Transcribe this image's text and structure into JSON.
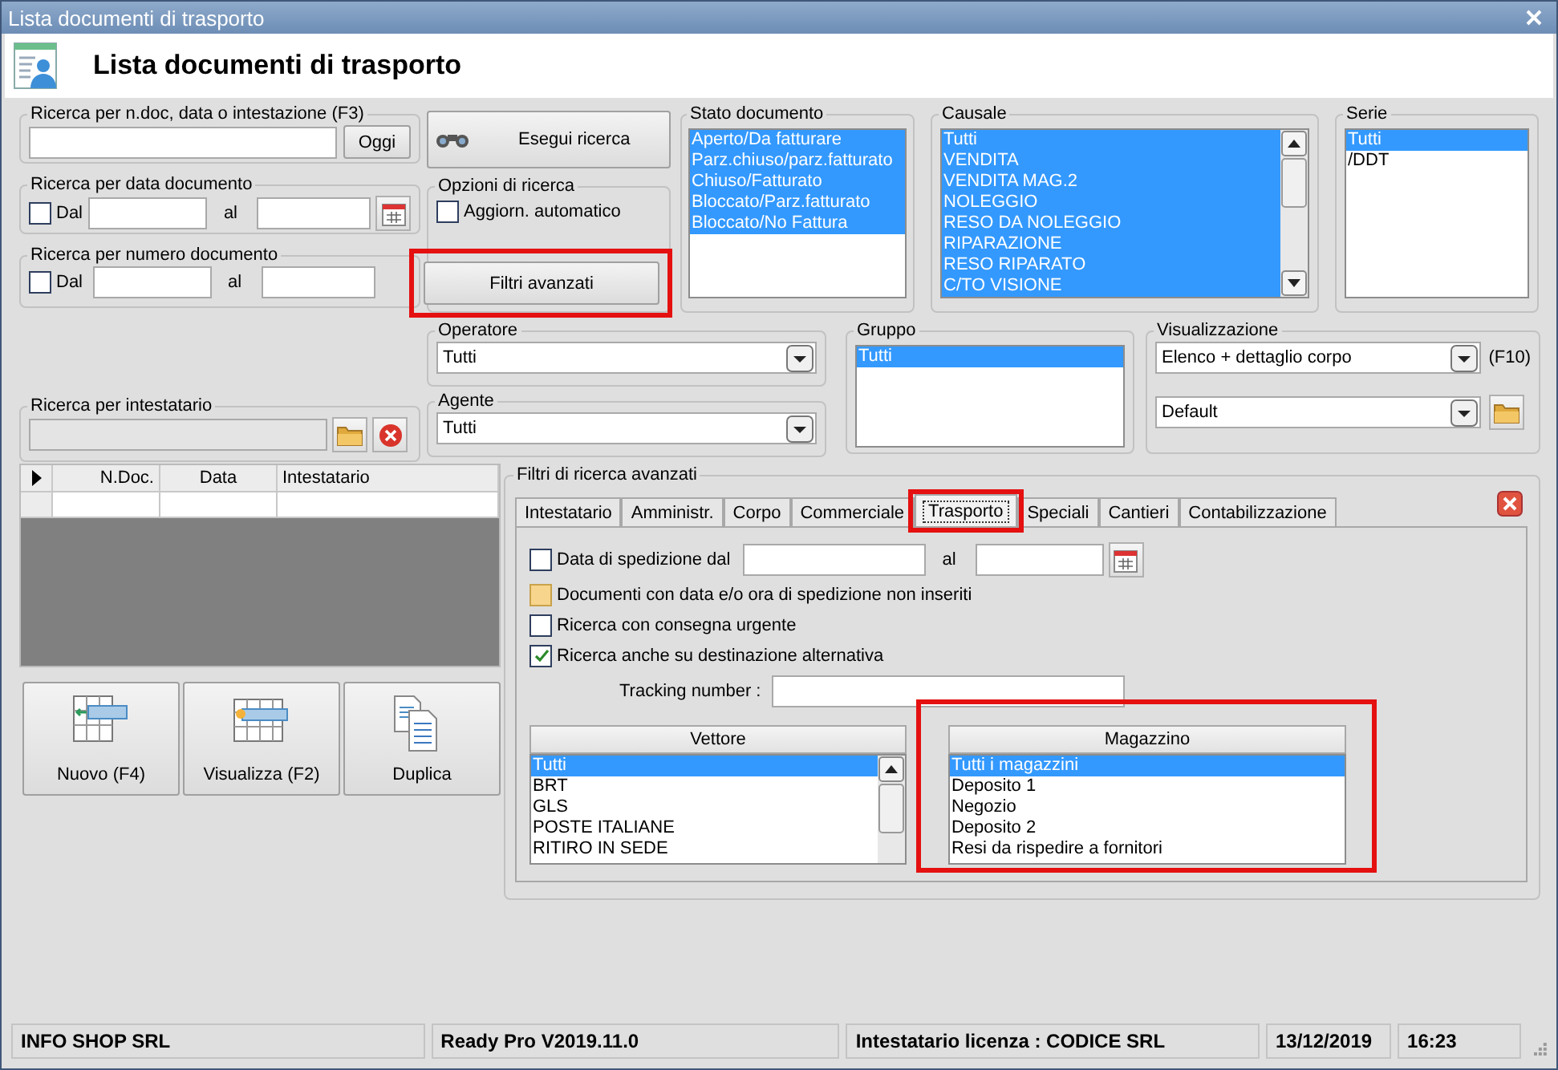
{
  "window": {
    "title": "Lista documenti di trasporto"
  },
  "header": {
    "title": "Lista documenti di trasporto"
  },
  "quick_search": {
    "label": "Ricerca per n.doc, data o intestazione (F3)",
    "button": "Oggi"
  },
  "date_search": {
    "label": "Ricerca per data documento",
    "from": {
      "label": "Dal",
      "checked": false
    },
    "to_label": "al"
  },
  "number_search": {
    "label": "Ricerca per numero documento",
    "from": {
      "label": "Dal",
      "checked": false
    },
    "to_label": "al"
  },
  "owner_search": {
    "label": "Ricerca per intestatario"
  },
  "search_button": "Esegui ricerca",
  "search_options": {
    "label": "Opzioni di ricerca",
    "auto_update": {
      "label": "Aggiorn. automatico",
      "checked": false
    },
    "advanced_button": {
      "label": "Filtri avanzati",
      "annotated": true
    }
  },
  "operator": {
    "label": "Operatore",
    "value": "Tutti"
  },
  "agent": {
    "label": "Agente",
    "value": "Tutti"
  },
  "document_state": {
    "label": "Stato documento",
    "items": [
      {
        "text": "Aperto/Da fatturare",
        "selected": true
      },
      {
        "text": "Parz.chiuso/parz.fatturato",
        "selected": true
      },
      {
        "text": "Chiuso/Fatturato",
        "selected": true
      },
      {
        "text": "Bloccato/Parz.fatturato",
        "selected": true
      },
      {
        "text": "Bloccato/No Fattura",
        "selected": true
      }
    ]
  },
  "reason": {
    "label": "Causale",
    "items": [
      {
        "text": "Tutti",
        "selected": true
      },
      {
        "text": "VENDITA",
        "selected": true
      },
      {
        "text": "VENDITA MAG.2",
        "selected": true
      },
      {
        "text": "NOLEGGIO",
        "selected": true
      },
      {
        "text": "RESO DA NOLEGGIO",
        "selected": true
      },
      {
        "text": "RIPARAZIONE",
        "selected": true
      },
      {
        "text": "RESO RIPARATO",
        "selected": true
      },
      {
        "text": "C/TO VISIONE",
        "selected": true
      }
    ]
  },
  "series": {
    "label": "Serie",
    "items": [
      {
        "text": "Tutti",
        "selected": true
      },
      {
        "text": "/DDT",
        "selected": false
      }
    ]
  },
  "group": {
    "label": "Gruppo",
    "items": [
      {
        "text": "Tutti",
        "selected": true
      }
    ]
  },
  "view": {
    "label": "Visualizzazione",
    "value": "Elenco + dettaglio corpo",
    "shortcut": "(F10)",
    "layout": "Default"
  },
  "table": {
    "columns": [
      "N.Doc.",
      "Data",
      "Intestatario"
    ]
  },
  "actions": [
    {
      "label": "Nuovo (F4)",
      "kind": "new"
    },
    {
      "label": "Visualizza (F2)",
      "kind": "view"
    },
    {
      "label": "Duplica",
      "kind": "copy"
    }
  ],
  "advanced": {
    "title": "Filtri di ricerca avanzati",
    "tabs": [
      {
        "label": "Intestatario",
        "selected": false,
        "annotated": false
      },
      {
        "label": "Amministr.",
        "selected": false,
        "annotated": false
      },
      {
        "label": "Corpo",
        "selected": false,
        "annotated": false
      },
      {
        "label": "Commerciale",
        "selected": false,
        "annotated": false
      },
      {
        "label": "Trasporto",
        "selected": true,
        "annotated": true
      },
      {
        "label": "Speciali",
        "selected": false,
        "annotated": false
      },
      {
        "label": "Cantieri",
        "selected": false,
        "annotated": false
      },
      {
        "label": "Contabilizzazione",
        "selected": false,
        "annotated": false
      }
    ],
    "ship_date": {
      "label": "Data di spedizione dal",
      "checked": false,
      "to_label": "al"
    },
    "options": [
      {
        "label": "Documenti con data e/o ora di spedizione non inseriti",
        "checked": false,
        "highlighted": true
      },
      {
        "label": "Ricerca con consegna urgente",
        "checked": false,
        "highlighted": false
      },
      {
        "label": "Ricerca anche su destinazione alternativa",
        "checked": true,
        "highlighted": false
      }
    ],
    "tracking": {
      "label": "Tracking number :"
    },
    "carrier": {
      "label": "Vettore",
      "items": [
        {
          "text": "Tutti",
          "selected": true
        },
        {
          "text": "BRT",
          "selected": false
        },
        {
          "text": "GLS",
          "selected": false
        },
        {
          "text": "POSTE ITALIANE",
          "selected": false
        },
        {
          "text": "RITIRO IN SEDE",
          "selected": false
        }
      ]
    },
    "warehouse": {
      "label": "Magazzino",
      "annotated": true,
      "items": [
        {
          "text": "Tutti i magazzini",
          "selected": true
        },
        {
          "text": "Deposito 1",
          "selected": false
        },
        {
          "text": "Negozio",
          "selected": false
        },
        {
          "text": "Deposito 2",
          "selected": false
        },
        {
          "text": "Resi da rispedire a fornitori",
          "selected": false
        }
      ]
    }
  },
  "status_bar": [
    "INFO SHOP SRL",
    "Ready Pro V2019.11.0",
    "Intestatario licenza : CODICE SRL",
    "13/12/2019",
    "16:23"
  ]
}
